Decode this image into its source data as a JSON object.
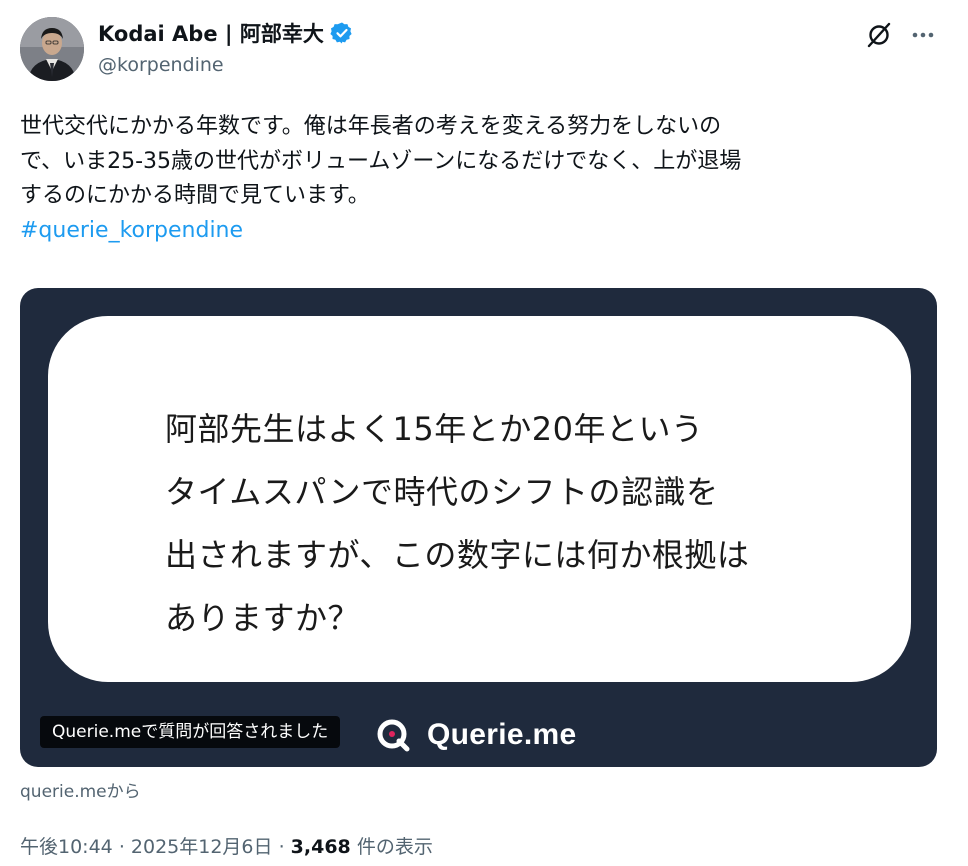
{
  "author": {
    "display_name": "Kodai Abe | 阿部幸大",
    "handle": "@korpendine",
    "verified_icon": "verified-badge-icon",
    "avatar_icon": "avatar-photo"
  },
  "actions": {
    "grok_icon": "grok-icon",
    "more_icon": "more-dots-icon"
  },
  "tweet": {
    "lines": [
      "世代交代にかかる年数です。俺は年長者の考えを変える努力をしないの",
      "で、いま25-35歳の世代がボリュームゾーンになるだけでなく、上が退場",
      "するのにかかる時間で見ています。"
    ],
    "hashtag": "#querie_korpendine"
  },
  "card": {
    "question_lines": [
      "阿部先生はよく15年とか20年という",
      "タイムスパンで時代のシフトの認識を",
      "出されますが、この数字には何か根拠は",
      "ありますか？"
    ],
    "brand_name": "Querie.me",
    "caption": "Querie.meで質問が回答されました",
    "colors": {
      "background": "#1f2a3d",
      "inner": "#ffffff"
    }
  },
  "source": "querie.meから",
  "meta": {
    "time": "午後10:44",
    "separator1": "·",
    "date": "2025年12月6日",
    "separator2": "·",
    "views_count": "3,468",
    "views_label": "件の表示"
  },
  "colors": {
    "link": "#1d9bf0",
    "secondary_text": "#536471",
    "primary_text": "#0f1419"
  }
}
